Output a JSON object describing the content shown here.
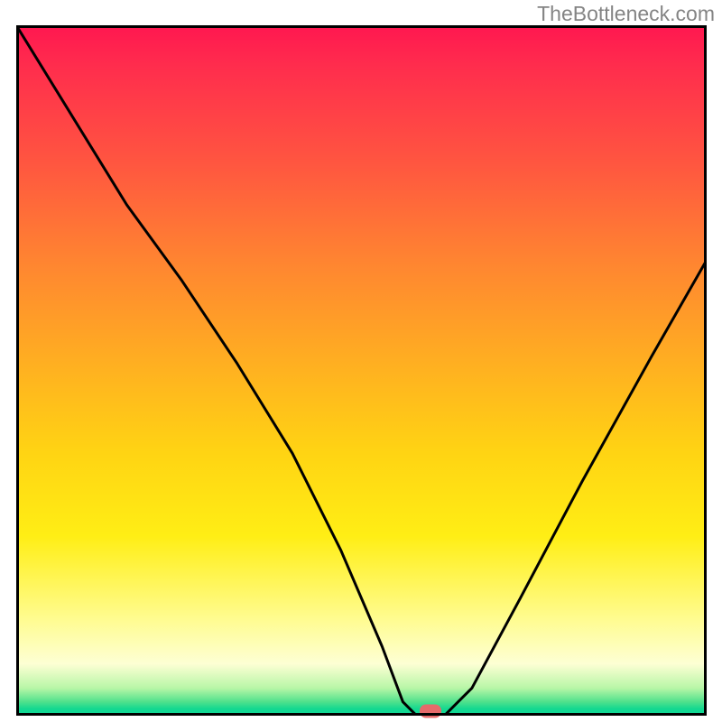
{
  "watermark": "TheBottleneck.com",
  "chart_data": {
    "type": "line",
    "title": "",
    "xlabel": "",
    "ylabel": "",
    "xlim": [
      0,
      100
    ],
    "ylim": [
      0,
      100
    ],
    "series": [
      {
        "name": "bottleneck-curve",
        "x": [
          0,
          8,
          16,
          24,
          32,
          40,
          47,
          53,
          56,
          58,
          62,
          66,
          73,
          82,
          92,
          100
        ],
        "values": [
          100,
          87,
          74,
          63,
          51,
          38,
          24,
          10,
          2,
          0,
          0,
          4,
          17,
          34,
          52,
          66
        ]
      }
    ],
    "minimum_marker": {
      "x": 60,
      "y": 0,
      "color": "#e66a6a"
    },
    "background_gradient": {
      "top": "#ff1750",
      "mid_upper": "#ff8730",
      "mid": "#ffee15",
      "mid_lower": "#fdffd4",
      "bottom": "#0fd695"
    }
  }
}
